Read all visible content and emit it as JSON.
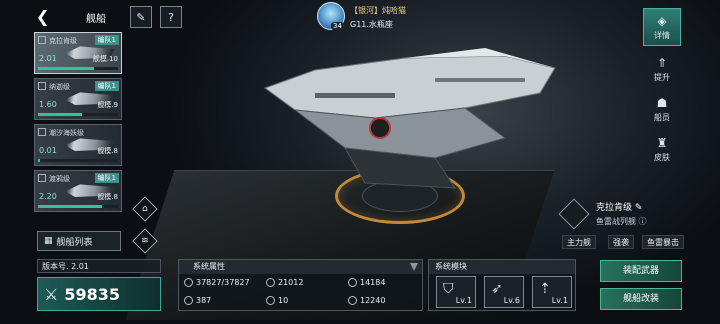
{
  "header": {
    "title": "舰船",
    "back_icon": "chevron-left-icon",
    "top_buttons": [
      "feather-icon",
      "help-icon"
    ]
  },
  "ship_list": [
    {
      "name": "克拉肯级",
      "fleet": "编队1",
      "level": "2.01",
      "scale": "舰模.10",
      "progress": 0.7,
      "active": true
    },
    {
      "name": "纳迦级",
      "fleet": "编队1",
      "level": "1.60",
      "scale": "舰模.9",
      "progress": 0.55,
      "active": false
    },
    {
      "name": "潮汐海妖级",
      "fleet": "",
      "level": "0.01",
      "scale": "舰模.8",
      "progress": 0.02,
      "active": false
    },
    {
      "name": "渡鸦级",
      "fleet": "编队1",
      "level": "2.20",
      "scale": "舰模.8",
      "progress": 0.8,
      "active": false
    }
  ],
  "list_button": "舰船列表",
  "version": "版本号. 2.01",
  "power": "59835",
  "attributes": {
    "title": "系统属性",
    "items": [
      {
        "icon": "shield-hp-icon",
        "value": "37827/37827"
      },
      {
        "icon": "armor-icon",
        "value": "21012"
      },
      {
        "icon": "energy-icon",
        "value": "14184"
      },
      {
        "icon": "speed-icon",
        "value": "387"
      },
      {
        "icon": "cargo-icon",
        "value": "10"
      },
      {
        "icon": "target-icon",
        "value": "12240"
      }
    ]
  },
  "modules": {
    "title": "系统模块",
    "items": [
      {
        "icon": "shield-module-icon",
        "level": "Lv.1"
      },
      {
        "icon": "missile-module-icon",
        "level": "Lv.6"
      },
      {
        "icon": "thruster-module-icon",
        "level": "Lv.1"
      }
    ]
  },
  "commander": {
    "name": "【银河】炖哈猫",
    "level": "34",
    "location": "G11.水瓶座"
  },
  "right_nav": [
    {
      "label": "详情",
      "icon": "details-icon",
      "active": true
    },
    {
      "label": "提升",
      "icon": "upgrade-icon",
      "active": false
    },
    {
      "label": "船员",
      "icon": "crew-icon",
      "active": false
    },
    {
      "label": "皮肤",
      "icon": "skin-icon",
      "active": false
    }
  ],
  "ship_info": {
    "name": "克拉肯级",
    "type": "鱼雷战列舰",
    "tags": [
      "主力舰",
      "强袭",
      "鱼雷暴击"
    ]
  },
  "actions": {
    "equip": "装配武器",
    "refit": "舰船改装"
  },
  "colors": {
    "accent": "#33c29a",
    "fleet_badge": "#3f8f8c",
    "commander_name": "#f1d67a"
  }
}
